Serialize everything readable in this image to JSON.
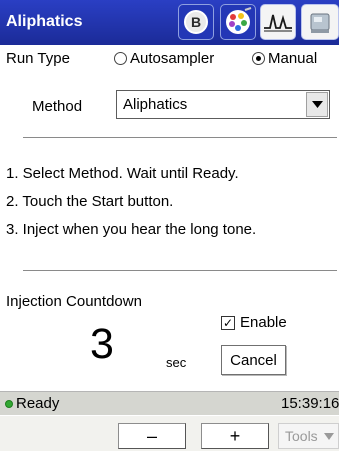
{
  "header": {
    "title": "Aliphatics",
    "icons": [
      "b-circle-icon",
      "color-palette-icon",
      "signal-waveform-icon",
      "instrument-icon"
    ]
  },
  "run_type": {
    "label": "Run Type",
    "options": [
      {
        "label": "Autosampler",
        "selected": false
      },
      {
        "label": "Manual",
        "selected": true
      }
    ]
  },
  "method": {
    "label": "Method",
    "selected_value": "Aliphatics"
  },
  "instructions": {
    "steps": [
      "1. Select Method. Wait until Ready.",
      "2. Touch the Start button.",
      "3. Inject when you hear the long tone."
    ]
  },
  "countdown": {
    "label": "Injection Countdown",
    "value": "3",
    "unit": "sec",
    "enable_label": "Enable",
    "enable_checked": true,
    "cancel_label": "Cancel"
  },
  "status": {
    "text": "Ready",
    "time": "15:39:16",
    "indicator_color": "#32a832"
  },
  "toolbar": {
    "minus_label": "–",
    "plus_label": "+",
    "tools_label": "Tools"
  },
  "colors": {
    "titlebar": "#1b2fa6",
    "statusbar": "#d5d6d0"
  }
}
